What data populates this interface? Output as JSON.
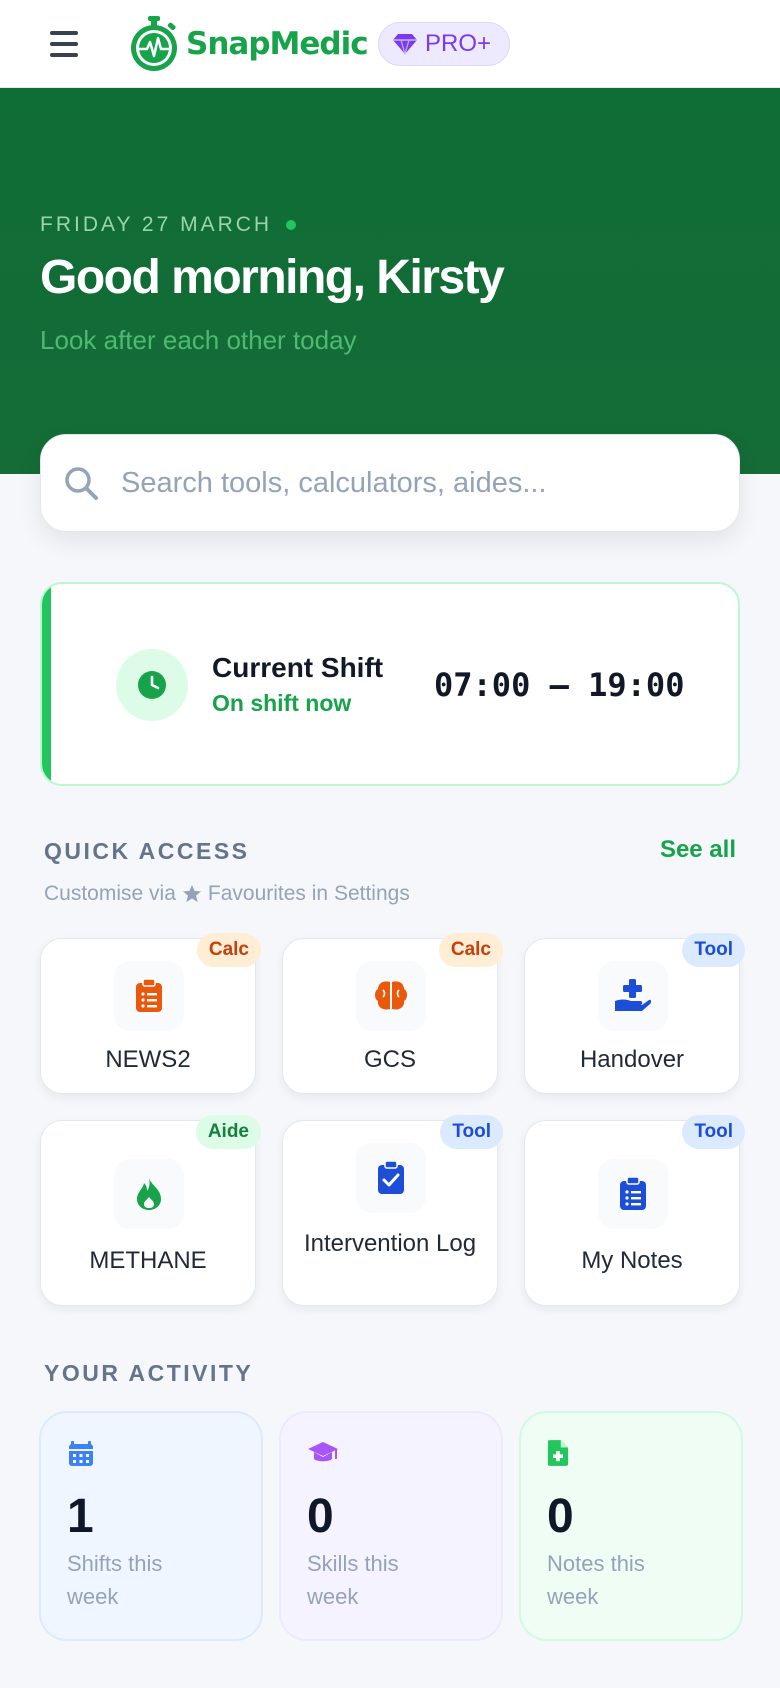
{
  "app": {
    "name": "SnapMedic",
    "badge": "PRO+"
  },
  "hero": {
    "date": "FRIDAY 27 MARCH",
    "greeting": "Good morning, Kirsty",
    "subtitle": "Look after each other today"
  },
  "search": {
    "placeholder": "Search tools, calculators, aides..."
  },
  "shift": {
    "label": "Current Shift",
    "status": "On shift now",
    "time": "07:00 – 19:00"
  },
  "quick_access": {
    "title": "QUICK ACCESS",
    "see_all": "See all",
    "hint_prefix": "Customise via",
    "hint_suffix": "Favourites in Settings",
    "tiles": [
      {
        "label": "NEWS2",
        "tag": "Calc",
        "icon": "clipboard-list-icon",
        "color": "#ea580c"
      },
      {
        "label": "GCS",
        "tag": "Calc",
        "icon": "brain-icon",
        "color": "#ea580c"
      },
      {
        "label": "Handover",
        "tag": "Tool",
        "icon": "hand-holding-medical-icon",
        "color": "#1d4ed8"
      },
      {
        "label": "METHANE",
        "tag": "Aide",
        "icon": "fire-icon",
        "color": "#16a34a"
      },
      {
        "label": "Intervention Log",
        "tag": "Tool",
        "icon": "clipboard-check-icon",
        "color": "#1d4ed8"
      },
      {
        "label": "My Notes",
        "tag": "Tool",
        "icon": "clipboard-list-icon",
        "color": "#1d4ed8"
      }
    ]
  },
  "activity": {
    "title": "YOUR ACTIVITY",
    "cards": [
      {
        "value": "1",
        "label": "Shifts this week",
        "icon": "calendar-icon",
        "color": "#3b82f6"
      },
      {
        "value": "0",
        "label": "Skills this week",
        "icon": "graduation-cap-icon",
        "color": "#a855f7"
      },
      {
        "value": "0",
        "label": "Notes this week",
        "icon": "file-medical-icon",
        "color": "#22c55e"
      }
    ]
  },
  "colors": {
    "brand": "#16a34a",
    "hero": "#0f6d36",
    "pro": "#7c3aed"
  }
}
